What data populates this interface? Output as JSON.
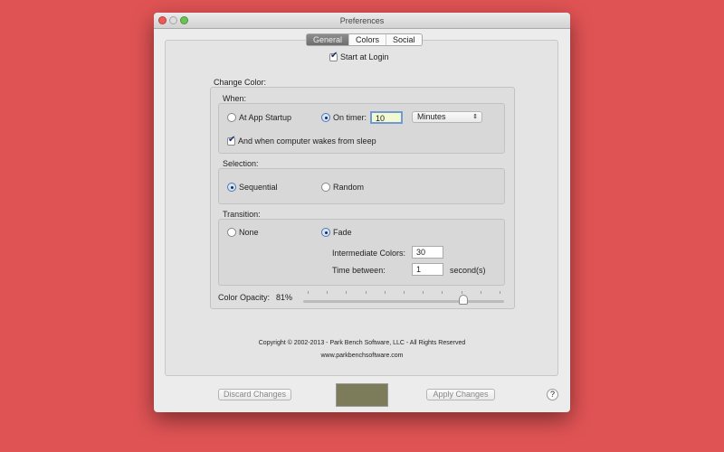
{
  "window": {
    "title": "Preferences"
  },
  "tabs": [
    {
      "label": "General",
      "active": true
    },
    {
      "label": "Colors",
      "active": false
    },
    {
      "label": "Social",
      "active": false
    }
  ],
  "start_at_login": {
    "label": "Start at Login",
    "checked": true
  },
  "change_color": {
    "label": "Change Color:",
    "when": {
      "label": "When:",
      "at_startup": "At App Startup",
      "on_timer": "On timer:",
      "timer_value": "10",
      "timer_unit": "Minutes",
      "wake_label": "And when computer wakes from sleep",
      "wake_checked": true,
      "selected": "on_timer"
    },
    "selection": {
      "label": "Selection:",
      "sequential": "Sequential",
      "random": "Random",
      "selected": "sequential"
    },
    "transition": {
      "label": "Transition:",
      "none": "None",
      "fade": "Fade",
      "selected": "fade",
      "intermediate_label": "Intermediate Colors:",
      "intermediate_value": "30",
      "time_label": "Time between:",
      "time_value": "1",
      "time_unit": "second(s)"
    },
    "opacity": {
      "label": "Color Opacity:",
      "value_text": "81%",
      "value": 81
    }
  },
  "footer": {
    "copyright": "Copyright © 2002-2013 - Park Bench Software, LLC - All Rights Reserved",
    "website": "www.parkbenchsoftware.com"
  },
  "buttons": {
    "discard": "Discard Changes",
    "apply": "Apply Changes",
    "help": "?"
  },
  "colors": {
    "preview": "#7d7c5a",
    "background": "#e05354"
  }
}
